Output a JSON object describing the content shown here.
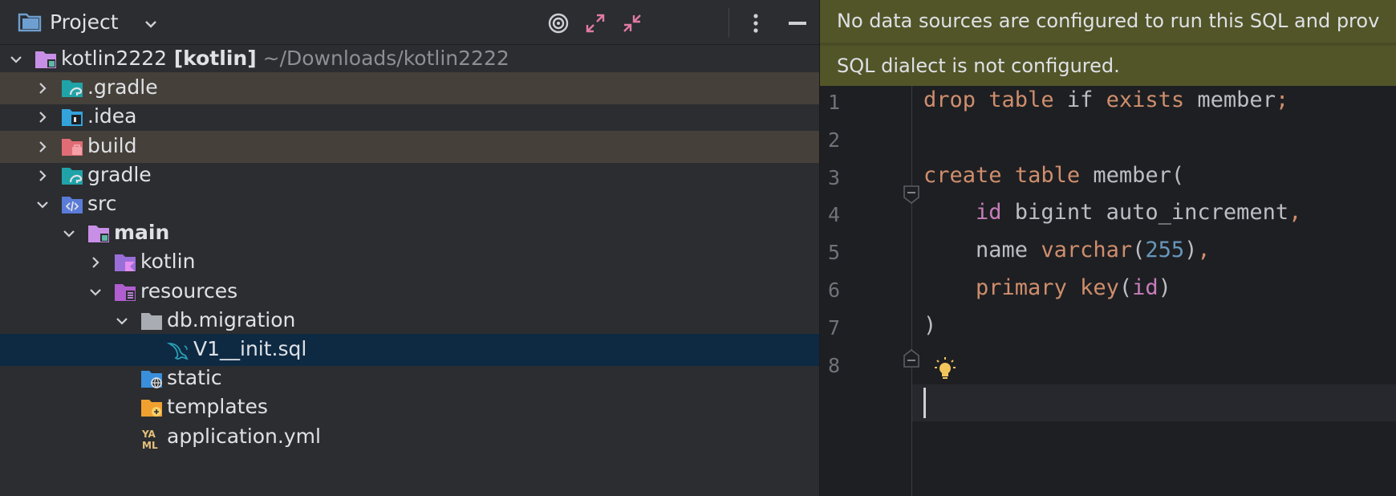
{
  "project_panel": {
    "title": "Project",
    "actions": [
      "locate-icon",
      "expand-all-icon",
      "collapse-all-icon",
      "more-icon",
      "hide-icon"
    ],
    "tree": [
      {
        "label": "kotlin2222",
        "suffix": "[kotlin]",
        "path": "~/Downloads/kotlin2222",
        "depth": 0,
        "state": "expanded",
        "icon": "module-folder-icon"
      },
      {
        "label": ".gradle",
        "depth": 1,
        "state": "collapsed",
        "icon": "gradle-folder-icon",
        "highlight": true
      },
      {
        "label": ".idea",
        "depth": 1,
        "state": "collapsed",
        "icon": "idea-folder-icon"
      },
      {
        "label": "build",
        "depth": 1,
        "state": "collapsed",
        "icon": "build-folder-icon",
        "highlight": true
      },
      {
        "label": "gradle",
        "depth": 1,
        "state": "collapsed",
        "icon": "gradle-folder-icon"
      },
      {
        "label": "src",
        "depth": 1,
        "state": "expanded",
        "icon": "source-folder-icon"
      },
      {
        "label": "main",
        "depth": 2,
        "state": "expanded",
        "icon": "module-folder-icon",
        "bold": true
      },
      {
        "label": "kotlin",
        "depth": 3,
        "state": "collapsed",
        "icon": "kotlin-folder-icon"
      },
      {
        "label": "resources",
        "depth": 3,
        "state": "expanded",
        "icon": "resources-folder-icon"
      },
      {
        "label": "db.migration",
        "depth": 4,
        "state": "expanded",
        "icon": "folder-icon"
      },
      {
        "label": "V1__init.sql",
        "depth": 5,
        "state": "leaf",
        "icon": "mysql-dolphin-icon",
        "selected": true
      },
      {
        "label": "static",
        "depth": 4,
        "state": "leaf",
        "icon": "web-folder-icon"
      },
      {
        "label": "templates",
        "depth": 4,
        "state": "leaf",
        "icon": "templates-folder-icon"
      },
      {
        "label": "application.yml",
        "depth": 4,
        "state": "leaf",
        "icon": "yaml-file-icon"
      }
    ]
  },
  "editor": {
    "banners": [
      "No data sources are configured to run this SQL and prov",
      "SQL dialect is not configured."
    ],
    "line_numbers": [
      "1",
      "2",
      "3",
      "4",
      "5",
      "6",
      "7",
      "8"
    ],
    "lines": [
      {
        "tokens": [
          {
            "t": "drop",
            "c": "kw"
          },
          {
            "t": " "
          },
          {
            "t": "table",
            "c": "kw"
          },
          {
            "t": " if "
          },
          {
            "t": "exists",
            "c": "kw"
          },
          {
            "t": " member"
          },
          {
            "t": ";",
            "c": "kw"
          }
        ]
      },
      {
        "tokens": []
      },
      {
        "tokens": [
          {
            "t": "create",
            "c": "kw"
          },
          {
            "t": " "
          },
          {
            "t": "table",
            "c": "kw"
          },
          {
            "t": " member("
          }
        ]
      },
      {
        "tokens": [
          {
            "t": "    "
          },
          {
            "t": "id",
            "c": "col"
          },
          {
            "t": " bigint auto_increment"
          },
          {
            "t": ",",
            "c": "kw"
          }
        ]
      },
      {
        "tokens": [
          {
            "t": "    name "
          },
          {
            "t": "varchar",
            "c": "kw"
          },
          {
            "t": "("
          },
          {
            "t": "255",
            "c": "numb"
          },
          {
            "t": ")"
          },
          {
            "t": ",",
            "c": "kw"
          }
        ]
      },
      {
        "tokens": [
          {
            "t": "    "
          },
          {
            "t": "primary",
            "c": "kw"
          },
          {
            "t": " "
          },
          {
            "t": "key",
            "c": "kw"
          },
          {
            "t": "("
          },
          {
            "t": "id",
            "c": "col"
          },
          {
            "t": ")"
          }
        ]
      },
      {
        "tokens": [
          {
            "t": ")"
          }
        ]
      },
      {
        "tokens": []
      }
    ],
    "current_line": "8"
  }
}
